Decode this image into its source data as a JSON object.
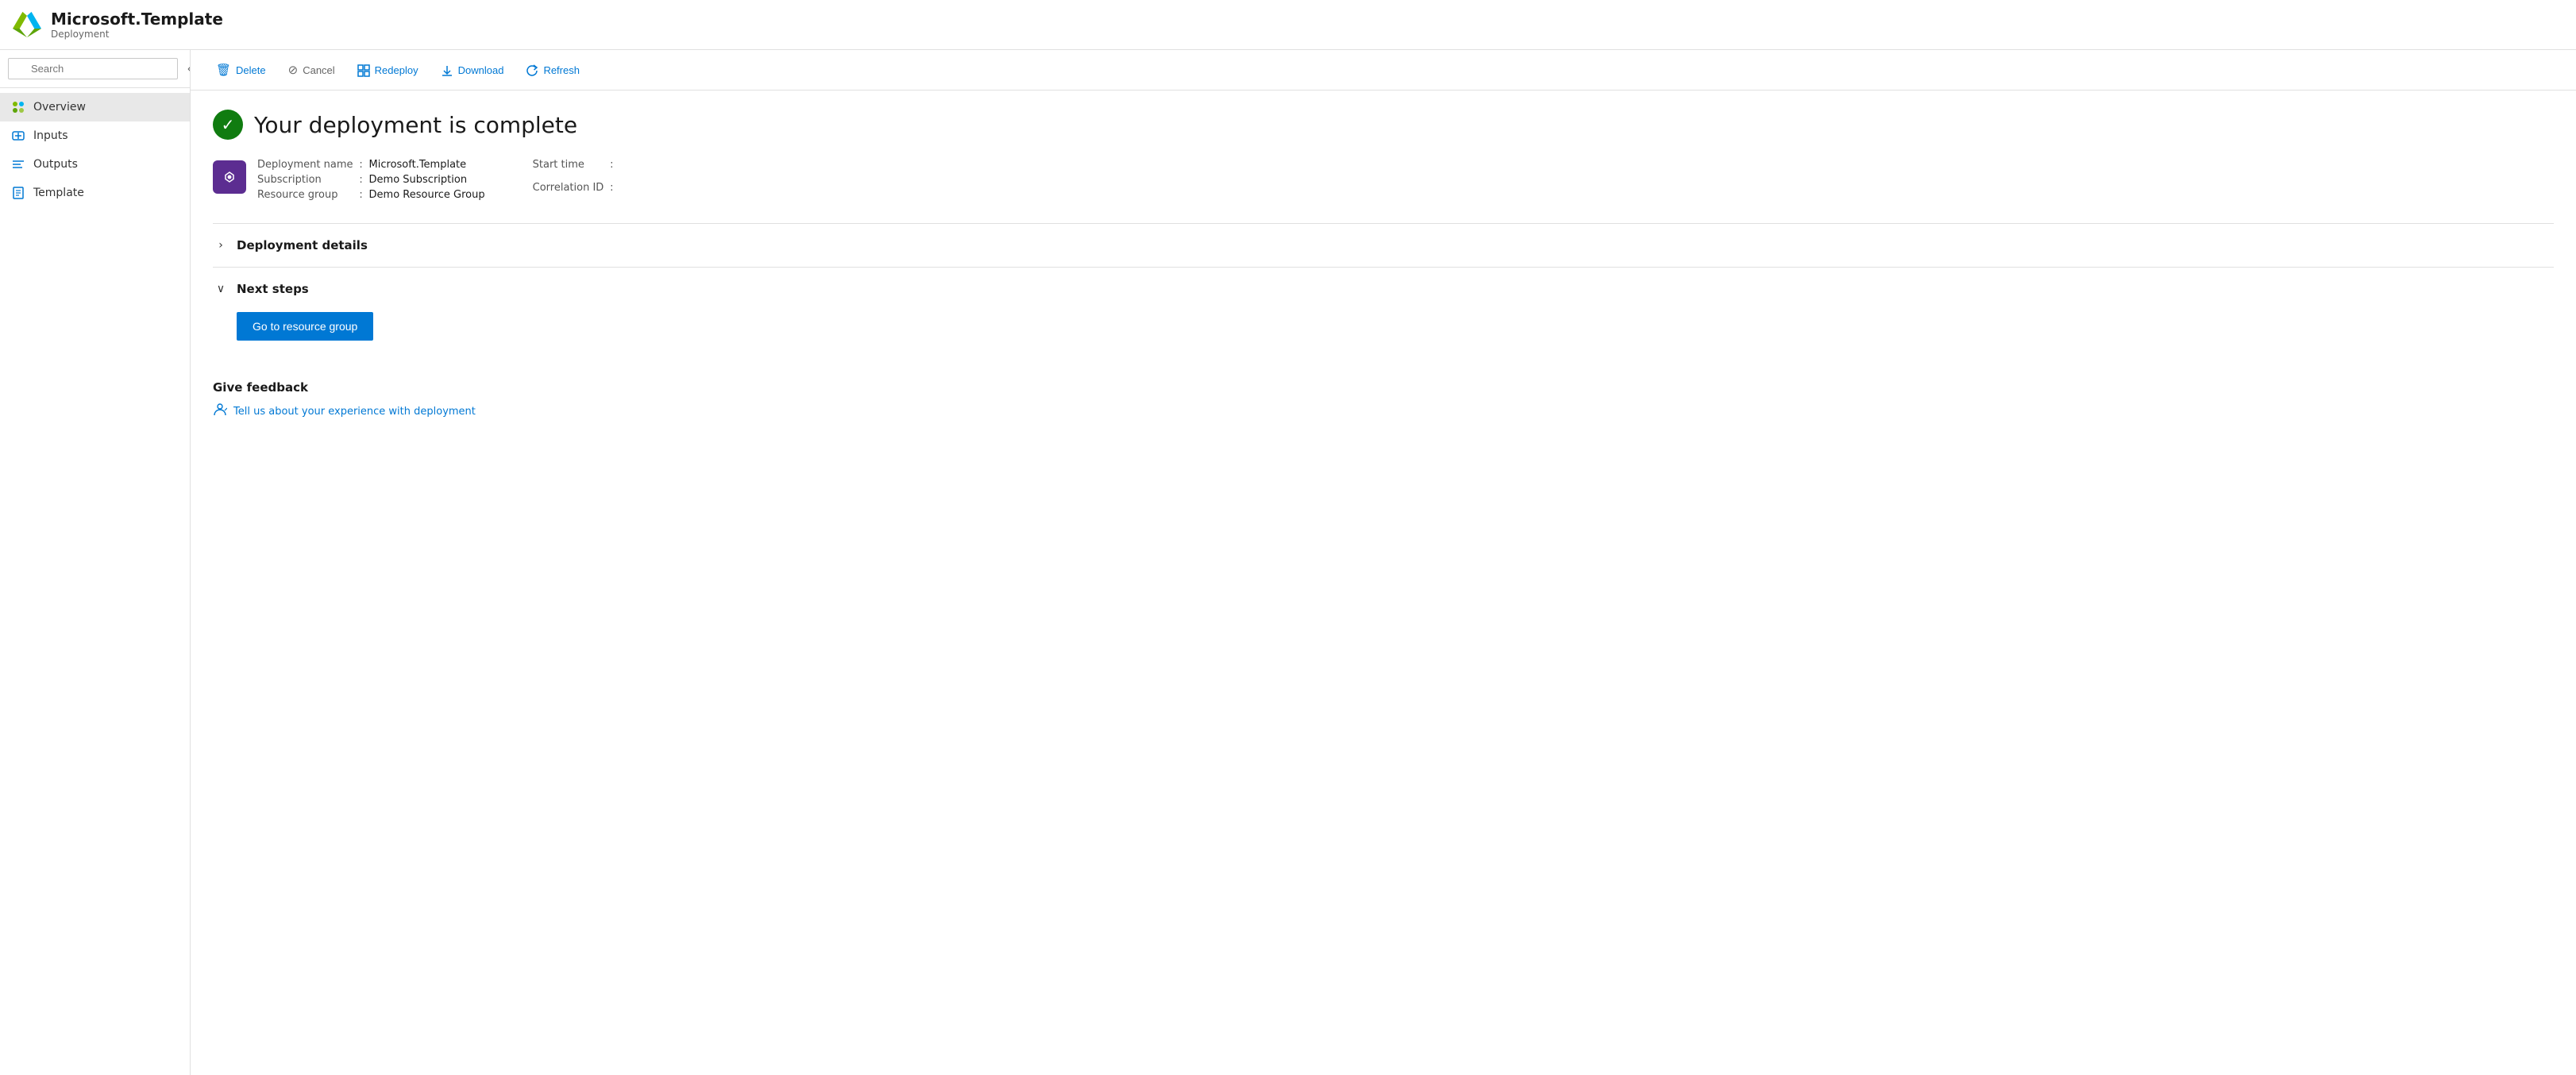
{
  "header": {
    "title": "Microsoft.Template",
    "subtitle": "Deployment",
    "logo_alt": "Azure logo"
  },
  "sidebar": {
    "search_placeholder": "Search",
    "collapse_label": "Collapse sidebar",
    "nav_items": [
      {
        "id": "overview",
        "label": "Overview",
        "active": true
      },
      {
        "id": "inputs",
        "label": "Inputs",
        "active": false
      },
      {
        "id": "outputs",
        "label": "Outputs",
        "active": false
      },
      {
        "id": "template",
        "label": "Template",
        "active": false
      }
    ]
  },
  "toolbar": {
    "delete_label": "Delete",
    "cancel_label": "Cancel",
    "redeploy_label": "Redeploy",
    "download_label": "Download",
    "refresh_label": "Refresh"
  },
  "content": {
    "success_title": "Your deployment is complete",
    "deployment": {
      "name_label": "Deployment name",
      "name_value": "Microsoft.Template",
      "subscription_label": "Subscription",
      "subscription_value": "Demo Subscription",
      "resource_group_label": "Resource group",
      "resource_group_value": "Demo Resource Group",
      "start_time_label": "Start time",
      "start_time_value": "",
      "correlation_id_label": "Correlation ID",
      "correlation_id_value": ""
    },
    "sections": [
      {
        "id": "deployment-details",
        "label": "Deployment details",
        "expanded": false,
        "chevron": "›"
      },
      {
        "id": "next-steps",
        "label": "Next steps",
        "expanded": true,
        "chevron": "∨"
      }
    ],
    "goto_button_label": "Go to resource group",
    "feedback": {
      "title": "Give feedback",
      "link_label": "Tell us about your experience with deployment"
    }
  }
}
